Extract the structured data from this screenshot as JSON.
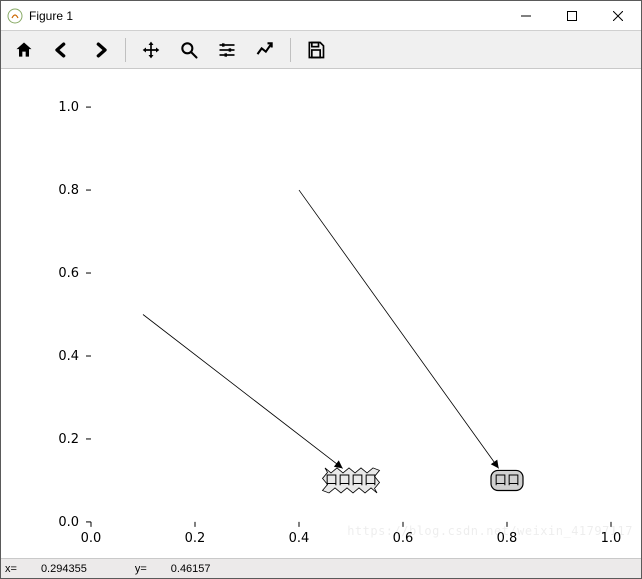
{
  "window": {
    "title": "Figure 1"
  },
  "toolbar": {
    "home": "Home",
    "back": "Back",
    "forward": "Forward",
    "pan": "Pan",
    "zoom": "Zoom",
    "configure": "Configure subplots",
    "edit": "Edit axis",
    "save": "Save"
  },
  "status": {
    "x_label": "x=",
    "x_value": "0.294355",
    "y_label": "y=",
    "y_value": "0.46157"
  },
  "watermark": "https://blog.csdn.net/weixin_41797117",
  "chart_data": {
    "type": "scatter",
    "xlim": [
      0.0,
      1.0
    ],
    "ylim": [
      0.0,
      1.0
    ],
    "xticks": [
      0.0,
      0.2,
      0.4,
      0.6,
      0.8,
      1.0
    ],
    "yticks": [
      0.0,
      0.2,
      0.4,
      0.6,
      0.8,
      1.0
    ],
    "xtick_labels": [
      "0.0",
      "0.2",
      "0.4",
      "0.6",
      "0.8",
      "1.0"
    ],
    "ytick_labels": [
      "0.0",
      "0.2",
      "0.4",
      "0.6",
      "0.8",
      "1.0"
    ],
    "annotations": [
      {
        "text": "口口口口",
        "xy": [
          0.5,
          0.1
        ],
        "xytext": [
          0.1,
          0.5
        ],
        "bbox_style": "sawtooth",
        "arrow": true
      },
      {
        "text": "口口",
        "xy": [
          0.8,
          0.1
        ],
        "xytext": [
          0.4,
          0.8
        ],
        "bbox_style": "round",
        "arrow": true
      }
    ]
  }
}
